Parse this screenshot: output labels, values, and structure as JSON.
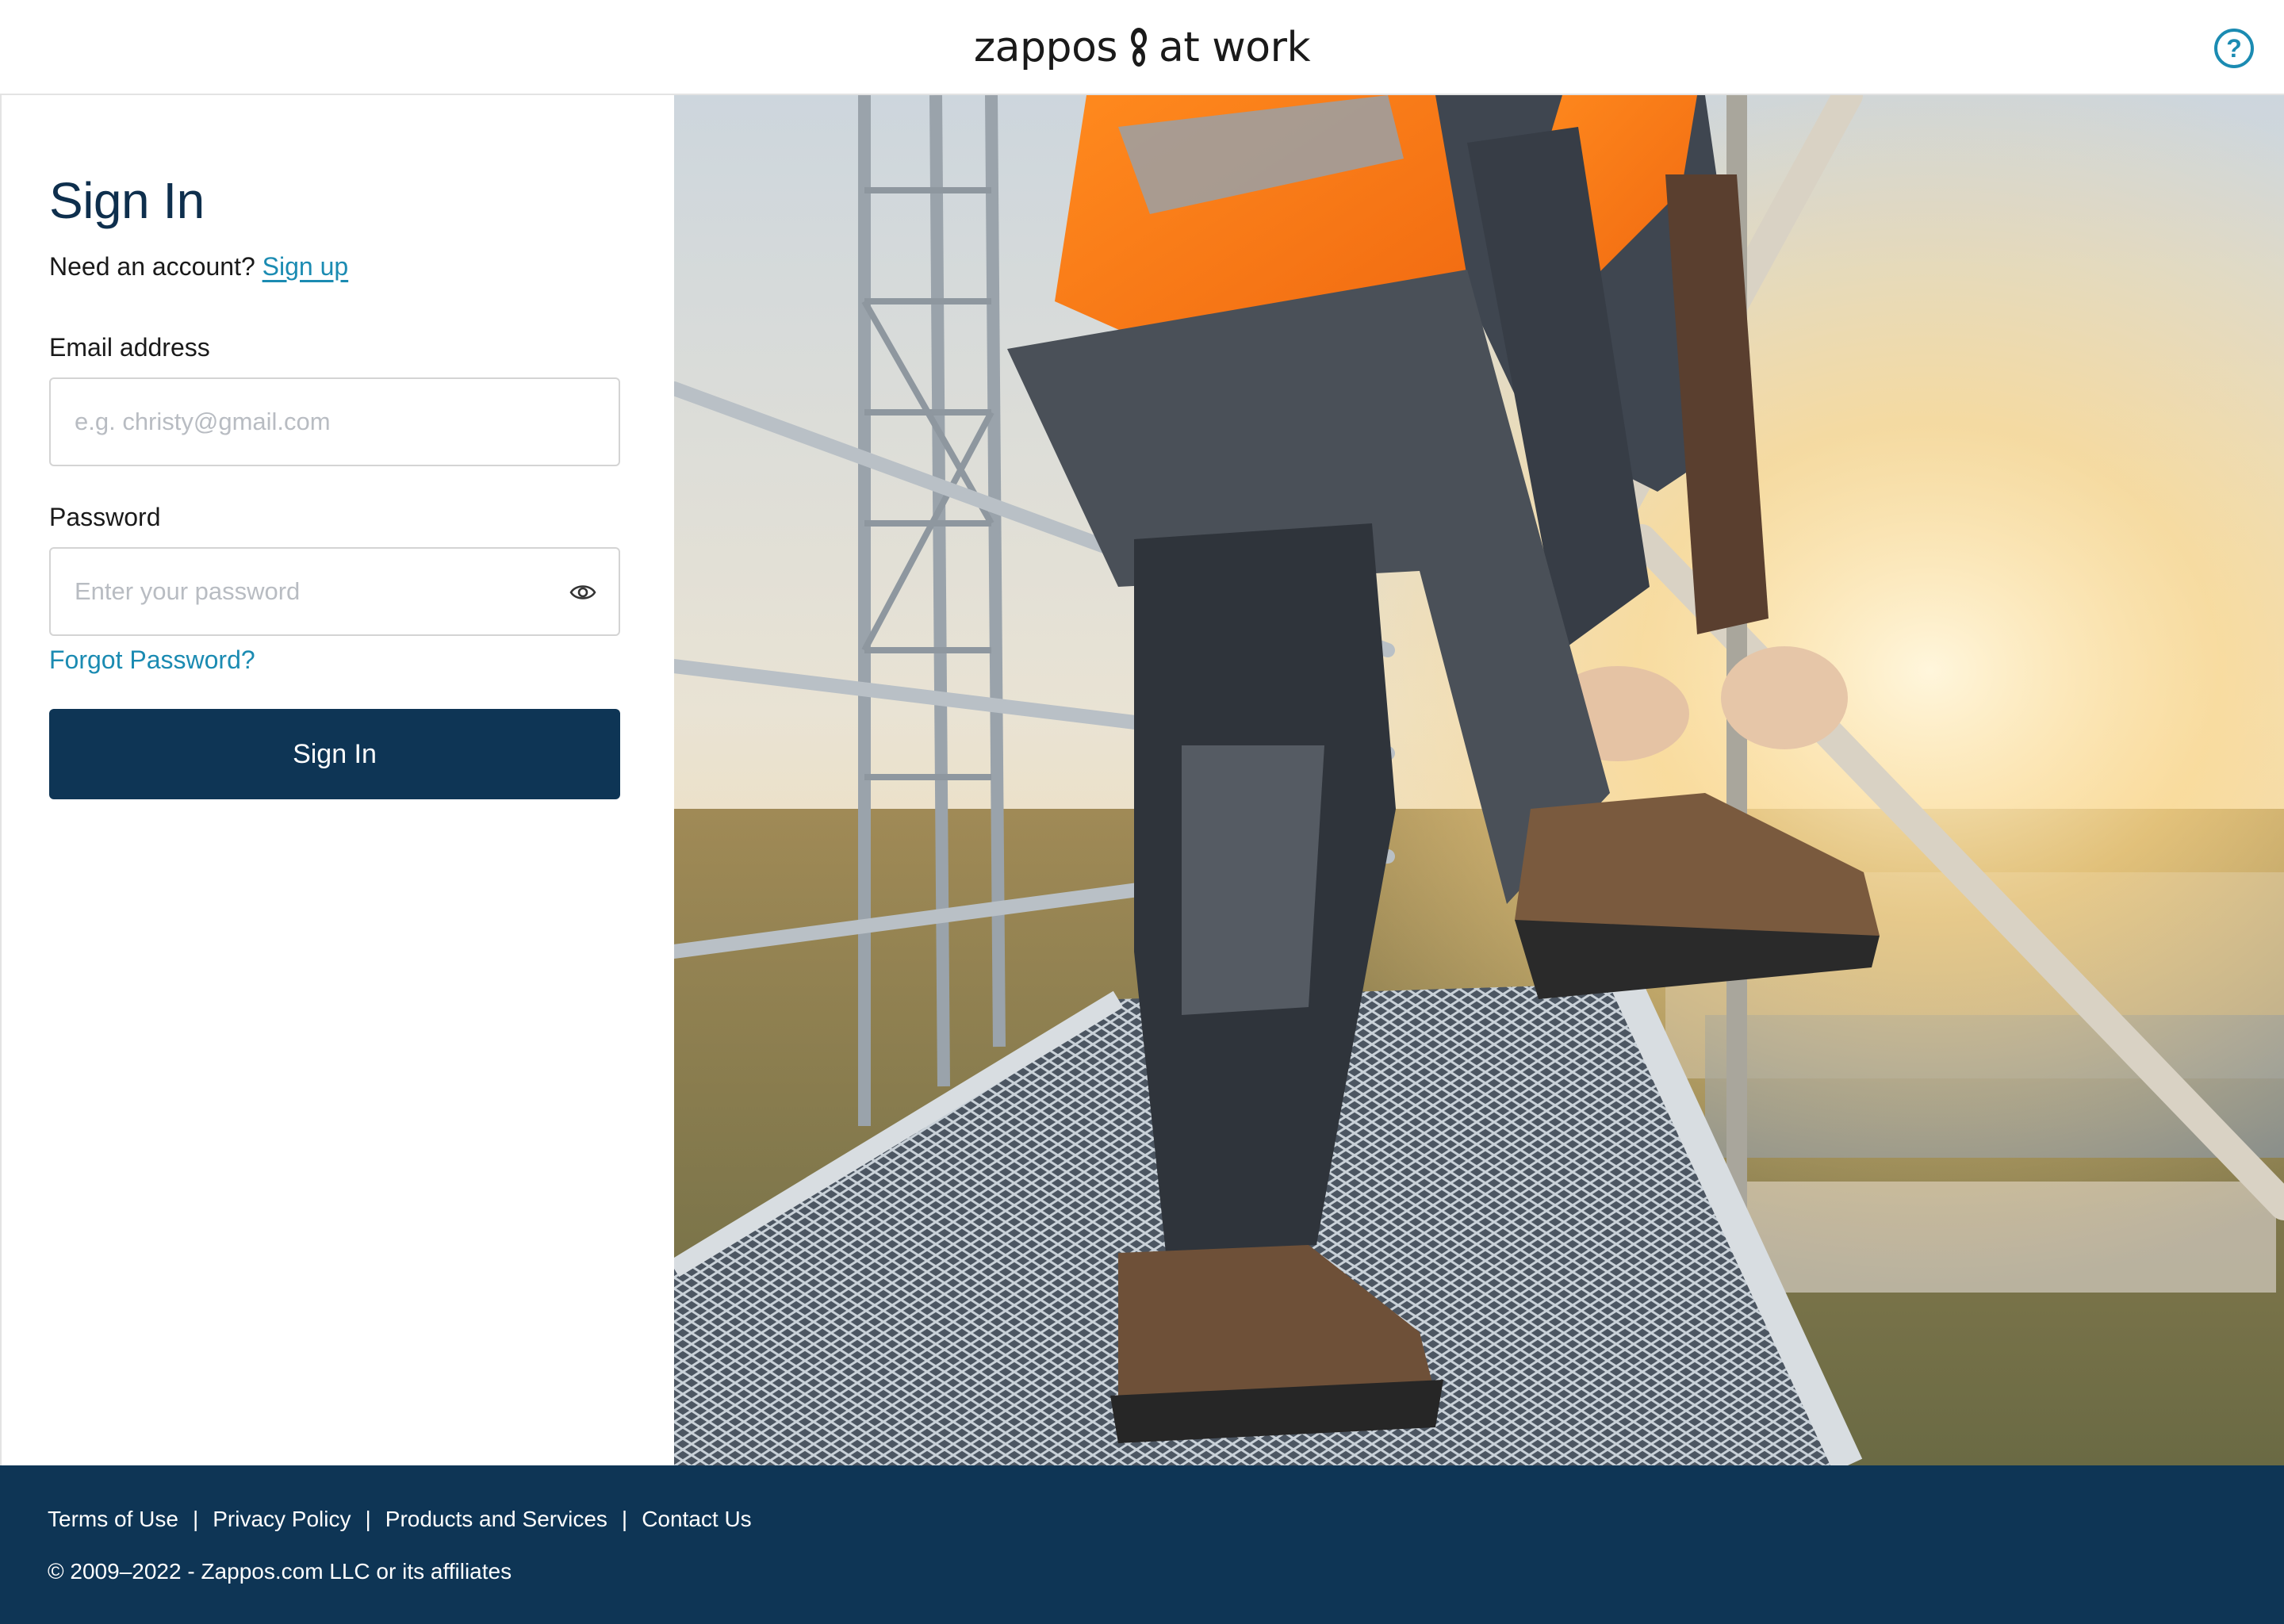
{
  "header": {
    "logo_left": "zappos",
    "logo_right": "at work",
    "help_label": "?"
  },
  "signin": {
    "title": "Sign In",
    "need_account": "Need an account?",
    "signup_link": "Sign up",
    "email_label": "Email address",
    "email_placeholder": "e.g. christy@gmail.com",
    "email_value": "",
    "password_label": "Password",
    "password_placeholder": "Enter your password",
    "password_value": "",
    "forgot_link": "Forgot Password?",
    "submit_label": "Sign In"
  },
  "icons": {
    "help": "question-mark-circle",
    "password_toggle": "eye",
    "logo_mark": "sneaker-sole"
  },
  "footer": {
    "links": [
      "Terms of Use",
      "Privacy Policy",
      "Products and Services",
      "Contact Us"
    ],
    "separator": "|",
    "copyright": "© 2009–2022 - Zappos.com LLC or its affiliates"
  },
  "colors": {
    "brand_navy": "#0e3555",
    "title_navy": "#0e2f4d",
    "link_blue": "#1b8bb2",
    "input_border": "#d4d4d4"
  }
}
